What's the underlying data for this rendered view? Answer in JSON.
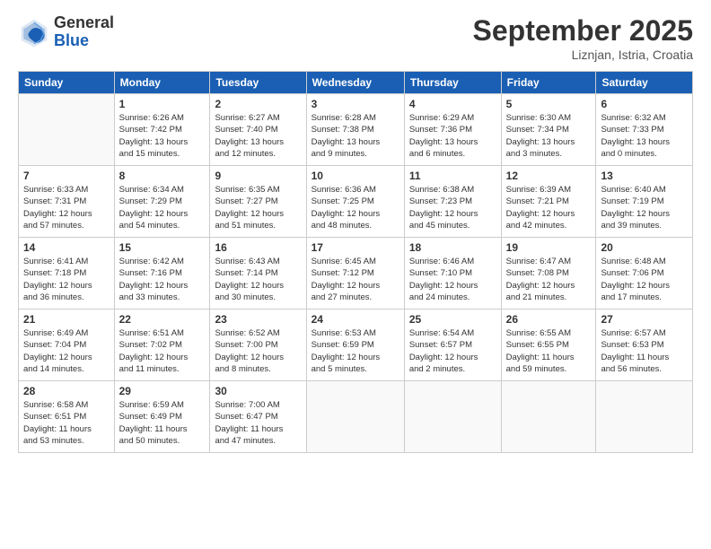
{
  "logo": {
    "general": "General",
    "blue": "Blue"
  },
  "header": {
    "month": "September 2025",
    "location": "Liznjan, Istria, Croatia"
  },
  "weekdays": [
    "Sunday",
    "Monday",
    "Tuesday",
    "Wednesday",
    "Thursday",
    "Friday",
    "Saturday"
  ],
  "weeks": [
    [
      {
        "day": "",
        "info": ""
      },
      {
        "day": "1",
        "info": "Sunrise: 6:26 AM\nSunset: 7:42 PM\nDaylight: 13 hours\nand 15 minutes."
      },
      {
        "day": "2",
        "info": "Sunrise: 6:27 AM\nSunset: 7:40 PM\nDaylight: 13 hours\nand 12 minutes."
      },
      {
        "day": "3",
        "info": "Sunrise: 6:28 AM\nSunset: 7:38 PM\nDaylight: 13 hours\nand 9 minutes."
      },
      {
        "day": "4",
        "info": "Sunrise: 6:29 AM\nSunset: 7:36 PM\nDaylight: 13 hours\nand 6 minutes."
      },
      {
        "day": "5",
        "info": "Sunrise: 6:30 AM\nSunset: 7:34 PM\nDaylight: 13 hours\nand 3 minutes."
      },
      {
        "day": "6",
        "info": "Sunrise: 6:32 AM\nSunset: 7:33 PM\nDaylight: 13 hours\nand 0 minutes."
      }
    ],
    [
      {
        "day": "7",
        "info": "Sunrise: 6:33 AM\nSunset: 7:31 PM\nDaylight: 12 hours\nand 57 minutes."
      },
      {
        "day": "8",
        "info": "Sunrise: 6:34 AM\nSunset: 7:29 PM\nDaylight: 12 hours\nand 54 minutes."
      },
      {
        "day": "9",
        "info": "Sunrise: 6:35 AM\nSunset: 7:27 PM\nDaylight: 12 hours\nand 51 minutes."
      },
      {
        "day": "10",
        "info": "Sunrise: 6:36 AM\nSunset: 7:25 PM\nDaylight: 12 hours\nand 48 minutes."
      },
      {
        "day": "11",
        "info": "Sunrise: 6:38 AM\nSunset: 7:23 PM\nDaylight: 12 hours\nand 45 minutes."
      },
      {
        "day": "12",
        "info": "Sunrise: 6:39 AM\nSunset: 7:21 PM\nDaylight: 12 hours\nand 42 minutes."
      },
      {
        "day": "13",
        "info": "Sunrise: 6:40 AM\nSunset: 7:19 PM\nDaylight: 12 hours\nand 39 minutes."
      }
    ],
    [
      {
        "day": "14",
        "info": "Sunrise: 6:41 AM\nSunset: 7:18 PM\nDaylight: 12 hours\nand 36 minutes."
      },
      {
        "day": "15",
        "info": "Sunrise: 6:42 AM\nSunset: 7:16 PM\nDaylight: 12 hours\nand 33 minutes."
      },
      {
        "day": "16",
        "info": "Sunrise: 6:43 AM\nSunset: 7:14 PM\nDaylight: 12 hours\nand 30 minutes."
      },
      {
        "day": "17",
        "info": "Sunrise: 6:45 AM\nSunset: 7:12 PM\nDaylight: 12 hours\nand 27 minutes."
      },
      {
        "day": "18",
        "info": "Sunrise: 6:46 AM\nSunset: 7:10 PM\nDaylight: 12 hours\nand 24 minutes."
      },
      {
        "day": "19",
        "info": "Sunrise: 6:47 AM\nSunset: 7:08 PM\nDaylight: 12 hours\nand 21 minutes."
      },
      {
        "day": "20",
        "info": "Sunrise: 6:48 AM\nSunset: 7:06 PM\nDaylight: 12 hours\nand 17 minutes."
      }
    ],
    [
      {
        "day": "21",
        "info": "Sunrise: 6:49 AM\nSunset: 7:04 PM\nDaylight: 12 hours\nand 14 minutes."
      },
      {
        "day": "22",
        "info": "Sunrise: 6:51 AM\nSunset: 7:02 PM\nDaylight: 12 hours\nand 11 minutes."
      },
      {
        "day": "23",
        "info": "Sunrise: 6:52 AM\nSunset: 7:00 PM\nDaylight: 12 hours\nand 8 minutes."
      },
      {
        "day": "24",
        "info": "Sunrise: 6:53 AM\nSunset: 6:59 PM\nDaylight: 12 hours\nand 5 minutes."
      },
      {
        "day": "25",
        "info": "Sunrise: 6:54 AM\nSunset: 6:57 PM\nDaylight: 12 hours\nand 2 minutes."
      },
      {
        "day": "26",
        "info": "Sunrise: 6:55 AM\nSunset: 6:55 PM\nDaylight: 11 hours\nand 59 minutes."
      },
      {
        "day": "27",
        "info": "Sunrise: 6:57 AM\nSunset: 6:53 PM\nDaylight: 11 hours\nand 56 minutes."
      }
    ],
    [
      {
        "day": "28",
        "info": "Sunrise: 6:58 AM\nSunset: 6:51 PM\nDaylight: 11 hours\nand 53 minutes."
      },
      {
        "day": "29",
        "info": "Sunrise: 6:59 AM\nSunset: 6:49 PM\nDaylight: 11 hours\nand 50 minutes."
      },
      {
        "day": "30",
        "info": "Sunrise: 7:00 AM\nSunset: 6:47 PM\nDaylight: 11 hours\nand 47 minutes."
      },
      {
        "day": "",
        "info": ""
      },
      {
        "day": "",
        "info": ""
      },
      {
        "day": "",
        "info": ""
      },
      {
        "day": "",
        "info": ""
      }
    ]
  ]
}
